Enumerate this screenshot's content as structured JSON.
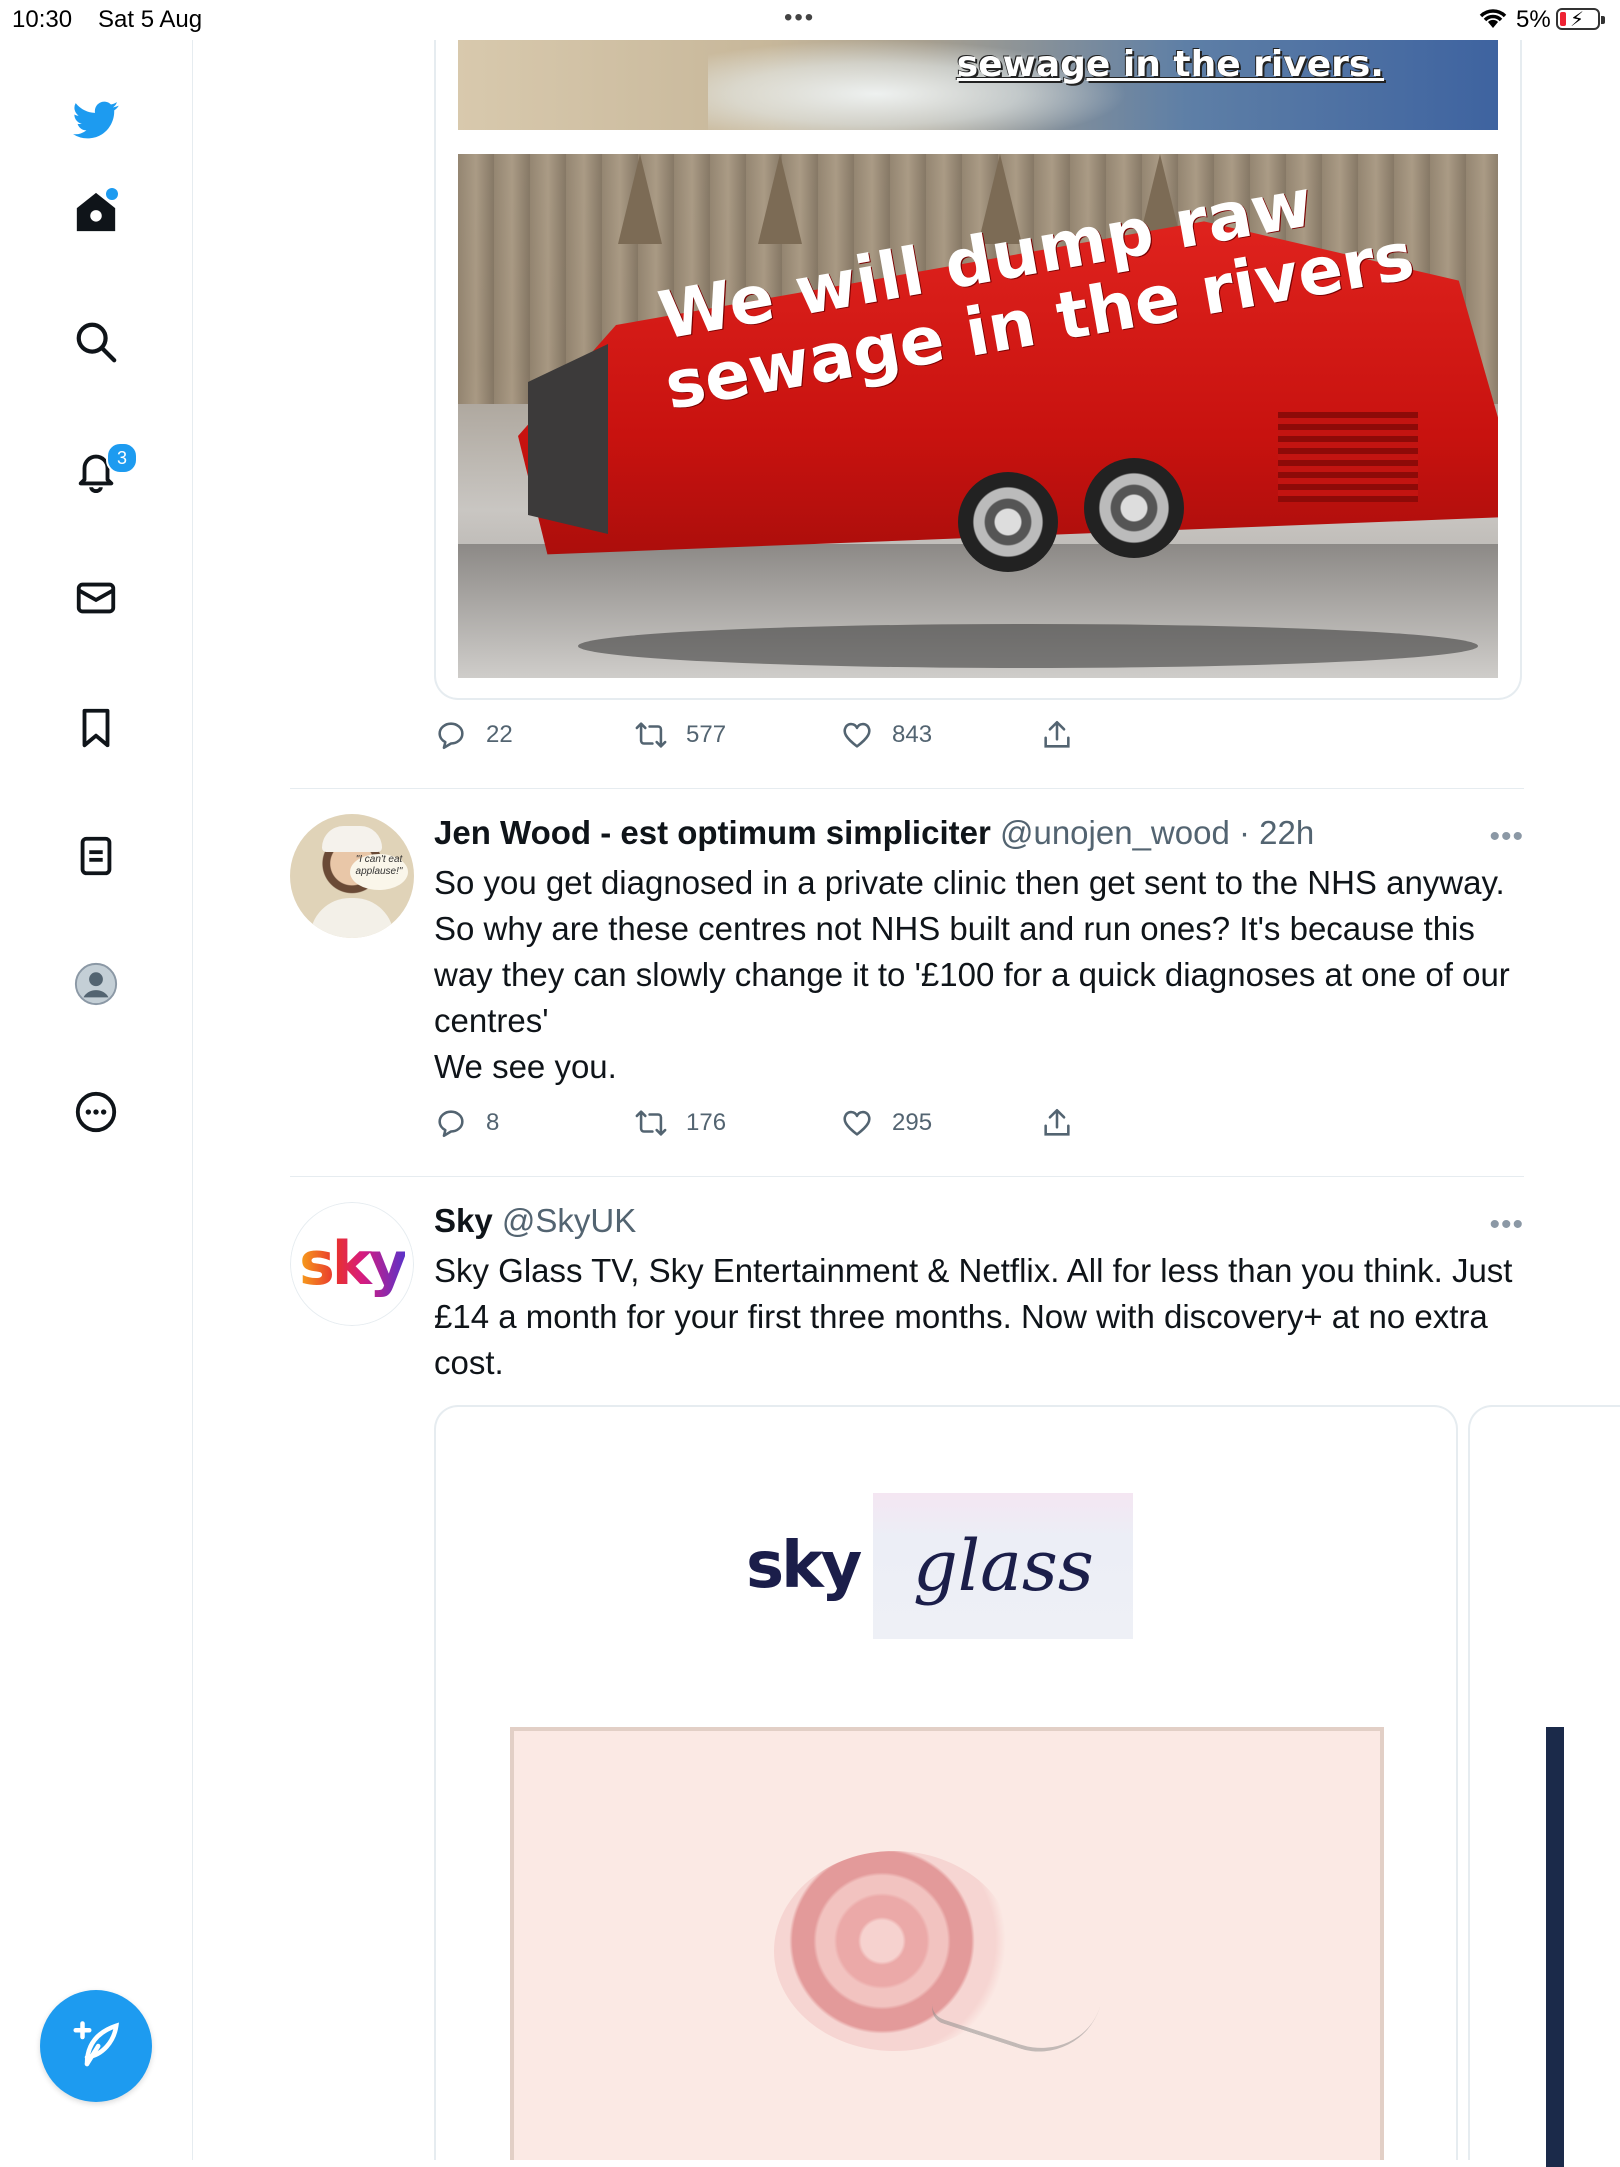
{
  "status_bar": {
    "time": "10:30",
    "date": "Sat 5 Aug",
    "battery_pct": "5%"
  },
  "nav": {
    "items": [
      {
        "name": "home",
        "icon": "home-icon"
      },
      {
        "name": "explore",
        "icon": "search-icon"
      },
      {
        "name": "notifications",
        "icon": "bell-icon",
        "badge": "3"
      },
      {
        "name": "messages",
        "icon": "mail-icon"
      },
      {
        "name": "bookmarks",
        "icon": "bookmark-icon"
      },
      {
        "name": "lists",
        "icon": "list-icon"
      },
      {
        "name": "profile",
        "icon": "profile-icon"
      },
      {
        "name": "more",
        "icon": "more-icon"
      }
    ],
    "notifications_badge": "3"
  },
  "tweet1": {
    "image_top_caption": "sewage in the rivers.",
    "image_bus_line1": "We will dump raw",
    "image_bus_line2": "sewage in the rivers",
    "replies": "22",
    "retweets": "577",
    "likes": "843"
  },
  "tweet2": {
    "name": "Jen Wood - est optimum simpliciter",
    "handle": "@unojen_wood",
    "time": "22h",
    "text": "So you get diagnosed in a private clinic then get sent to the NHS anyway. So why are these centres not NHS built and run ones?  It's because this way they can slowly change it to '£100 for a quick diagnoses at one of our centres'\nWe see you.",
    "avatar_caption": "\"I can't eat applause!\"",
    "replies": "8",
    "retweets": "176",
    "likes": "295"
  },
  "tweet3": {
    "name": "Sky",
    "handle": "@SkyUK",
    "text": "Sky Glass TV, Sky Entertainment & Netflix. All for less than you think. Just £14 a month for your first three months. Now with discovery+ at no extra cost.",
    "avatar_logo": "sky",
    "promo_brand": "sky",
    "promo_product": "glass"
  },
  "colors": {
    "accent": "#1d9bf0",
    "muted": "#536471",
    "sky_navy": "#1b1e4a"
  }
}
